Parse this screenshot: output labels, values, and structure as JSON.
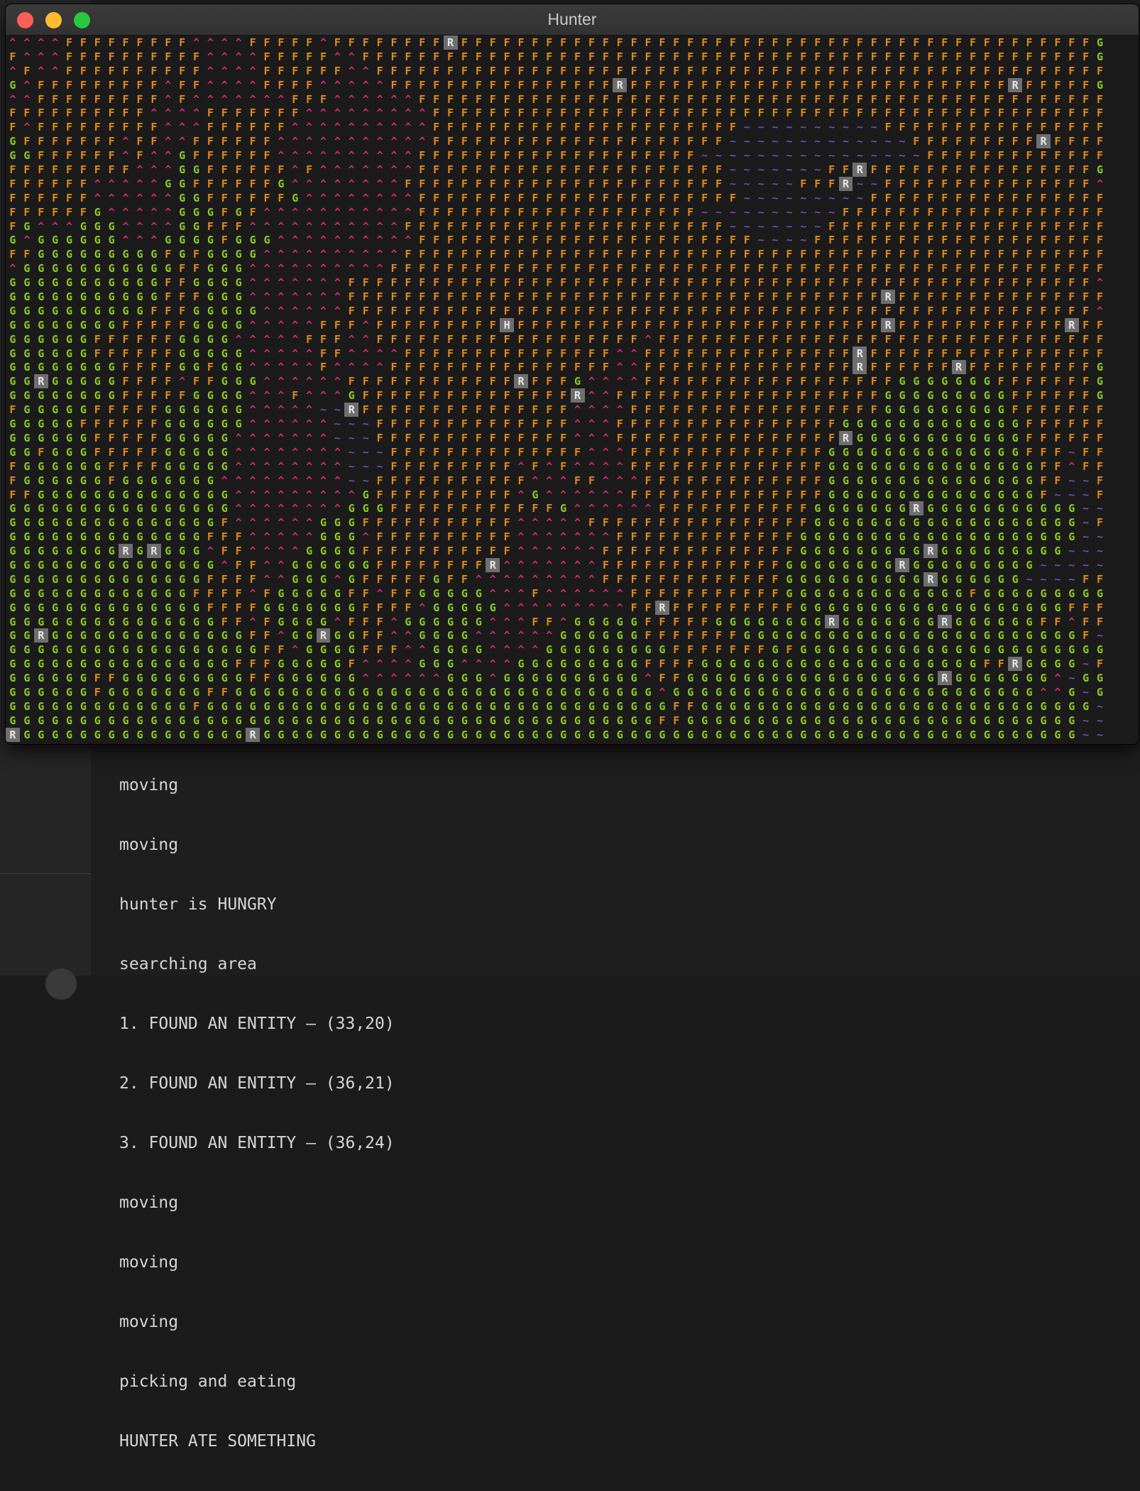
{
  "window": {
    "title": "Hunter"
  },
  "legend": {
    "F": "F",
    "G": "G",
    "M": "^",
    "W": "~",
    "R": "R",
    "H": "H"
  },
  "map": {
    "rows": [
      "MMMMFFFFFFFFFMMMMFFFFFMFFFFFFFFRFFFFFFFFFFFFFFFFFFFFFFFFFFFFFFFFFFFFFFFFFFFFFG",
      "FMMMFFFFFFFFFFMMMMFFFFFMMFFFFFFFFFFFFFFFFFFFFFFFFFFFFFFFFFFFFFFFFFFFFFFFFFFFFG",
      "MFMMFFFFFFFFFFMMMMFFFFFFMMFFFFFFFFFFFFFFFFFFFFFFFFFFFFFFFFFFFFFFFFFFFFFFFFFFFF",
      "GMFFFFFFFFFMFFMMMMFFFFMMMMMFFFFFFFFFFFFFFFFRFFFFFFFFFFFFFFFFFFFFFFFFFFFRFFFFFG",
      "MMFFFFFFFFFMFMMMMMMMFFFMMMMMMFFFFFFFFFFFFFFFFFFFFFFFFFFFFFFFFFFFFFFFFFFFFFFFFF",
      "FFFFFFFFFFMMMMFFFFFFFMMMMMMMMMFFFFFFFFFFFFFFFFFFFFFFFFFFFFFFFFFFFFFFFFFFFFFFFF",
      "FMFFFFFFFFFMMMFFFFFFMMMMMMMMMMFFFFFFFFFFFFFFFFFFFFFFWWWWWWWWWWFFFFFFFFFFFFFFFF",
      "GFFFFFFFMFFMMFFFFFFMMMMMMMMMMMFFFFFFFFFFFFFFFFFFFFFWWWWWWWWWWWWWFFFFFFFFFRFFFF",
      "GGFFFFFFMFMMGFFFFFFMMMMMMMMMMFFFFFFFFFFFFFFFFFFFFWWWWWWWWWWWWWWWWFFFFFFFFFFFFF",
      "FFFFFFFFFMMMGGFFFFFFMFMMMMMMMFFFFFFFFFFFFFFFFFFFFFFWWWWWWWFFRFFFFFFFFFFFFFFFFG",
      "FFFFFFMMMMMGGFFFFFFGMMMMMMMMFFFFFFFFFFFFFFFFFFFFFFFWWWWWFFFRWWFFFFFFFFFFFFFFFM",
      "FFFFFFMMMMMMGGFFFFFFGMMMMMMMMFFFFFFFFFFFFFFFFFFFFFFFWWWWWWWWWFFFFFFFFFFFFFFFFF",
      "FFFFFFGMMMMMGGGFGFMMMMMMMMMMMFFFFFFFFFFFFFFFFFFFFWWWWWWWWWWFFFFFFFFFFFFFFFFFFF",
      "FGMMMGGGMMMMGGFFFMMMMMMMMMMMFFFFFFFFFFFFFFFFFFFFFFFWWWWWWWFFFFFFFFFFFFFFFFFFFF",
      "GMGGGGGGMMMGGGGFGGGMMMMMMMMMMFFFFFFFFFFFFFFFFFFFFFFFFWWWWFFFFFFFFFFFFFFFFFFFFF",
      "FFGGGGGGGGGFGFGGGGMMMMMMMMMMFFFFFFFFFFFFFFFFFFFFFFFFFFFFFFFFFFFFFFFFFFFFFFFFFF",
      "MGGGGGGGGGGGFFGGGMMMMMMMMMMFFFFFFFFFFFFFFFFFFFFFFFFFFFFFFFFFFFFFFFFFFFFFFFFFFF",
      "GGGGGGGGGGGFFGGGGMMMMMMMFFFFFFFFFFFFFFFFFFFFFFFFFFFFFFFFFFFFFFFFFFFFFFFFFFFFFM",
      "GGGGGGGGGGGFFFGGGMMMMMMMFFFFFFFFFFFFFFFFFFFFFFFFFFFFFFFFFFFFFFRFFFFFFFFFFFFFFF",
      "GGGGGGGGGGFFFGGGGGMMMMMMFFFFFFFFFFFFFFFFFFFFFFFFFFFFFFFFFFFFFFFFFFFFFFFFFFFFFM",
      "GGGGGGGGFFFFFGGGGMMMMMFFFMFFFFFFFFFHFFFFFFFFFFFFFFFFFFFFFFFFFFRFFFFFFFFFFFFRFF",
      "GGGGGGFFFFFFGGGGMMMMMFFFMMFFFFFFFFFFFFFFFFFFFMFFFFFFFFFFFFFFFFFFFFFFFFFFFFFFFF",
      "GGGGGGFFFFFFGGGGGMMMMMFFMMMMFFFFFFFFFFFFFFFMMFFFFFFFFFFFFFFFRFFFFFFFFFFFFFFFFF",
      "GGGGGGGGFFFFGGFGGMMMMMFMMMMFFFFFFFFFFFFFFFFMMFFFFFFFFFFFFFFFRFFFFFFRFFFFFFFFFG",
      "GGRGGGGGFFFFMFFGGGMMMMMMFFFFFFFFFFFFRFFFGMMMMFFFFFFFFFFFFFFFFFFGGGGGGGFFFFFFFG",
      "GGGGGGGGFFFFFGGGGMMMFMMMGFFFFFFFFFFFFFFFRMMFFFFFFFFFFFFFFFFFFFGGGGGGGGGFFFFFFG",
      "FGGGGGFFFFFGGGGGGMMMMMWWRFFFFFFFFFFFFFFFMMMMFFFFFFFFFFFFFFFFFFGGGGGGGGGFFFFFFF",
      "GGGGGFFFFFFGGGGGGMMMMMMWWWFFFFFFFFFFFFFFMMMFFFFFFFFFFFFFFFFGGGGGGGGGGGGGFFFFFF",
      "GGGGGGFFFFFGGGGGMMMMMMMWWWFFFFFFFFFFFFFFMMMFFFFFFFFFFFFFFFFRGGGGGGGGGGGGFFFFFF",
      "GGFGGGFFFFFGGGGGMMMMMMMMWWWFFFFFFFFFFFFFFMMMFFFFFFFFFFFFFFGGGGGGGGGGGGGGFFFWFF",
      "FGGGGGGFFFFGGGGGMMMMMMMMWWWFFFFFFFFFMFMFMMMMFFFFFFFFFFFFFFGGGGGGGGGGGGGGGFFMFF",
      "FGGGGGGFGGGGGGGMMMMMMMMMWWFFFFFFFFFFFMMMFFMMMFFFFFFFFFFFFFGGGGGGGGGGGGGGGFFWWF",
      "FFGGGGGGGGGGGGGGMMMMMMMMMGFFFFFFFFFFMGMMMMMMFFFFFFFFFFFFFFGGGGGGGGGGGGGGGFWWWF",
      "GGGGGGGGGGGGGGGGMMMMMMMMGGGFFFFFFFFFFFFGMMMMMMFFFFFFFFFFFGGGGGGGRGGGGGGGGGGGWW",
      "GGGGGGGGGGGGGGGFMMMMMMGGGFFFFFFFFFFFMMMMMFFFFFFFFFFFFFFFFGGGGGGGGGGGGGGGGGGGWF",
      "GGGGGGGGGGGGGGFFFMMMMMGGGMFFFFFFFFFFMMMMMMMFFFFFFFFFFFFFGGGGGGGGGGGGGGGGGGGGWW",
      "GGGGGGGGRGRGGGMFFMMMMGGGGFFFFFFFFFFFMMMMMMFFFFFFFFFFFFFFGGGGGGGGGRGGGGGGGGGWWW",
      "GGGGGGGGGGGGGGGMFFMMGGGGGGFFFFFFFFRMMMMMMMFFFFFFFFFFFFFGGGGGGGGRGGGGGGGGGWWWWW",
      "GGGGGGGGGGGGGGFFFFMMGGGMGFFFFFGFFMMMMMMMMMFFFFFFFFFFFFFGGGGGGGGGGRGGGGGGWWWWFF",
      "GGGGGGGGGGGGGFFFFMFGGGGGFFMFFGGGGGMMMFMMMMMMFFFFFFFFFFFGGGGGGGGGGGGGFGGGGGGGGG",
      "GGGGGGGGGGGGGGFFFFGGGGGGGFFFFMGGGGGMMMMMMMMMFFRFFFFFFFFFGGGGGGGGGGGGGGGGGGGFFF",
      "GGGGGGGGGGGGGGGFFMFGGGGMFFFMGGGGGGMMMFFMGGGGGFFFFFGGGGGGGGRGGGGGGGRGGGGGGFFMFF",
      "GGRGGGGGGGGGGGGGGFFMGGRGGFFMMGGGGMMMMMMGGGGGGFFFFFFFGGGGGGGGGGGGGGGGGGGGGGGGFW",
      "GGGGGGGGGGGGGGGGGGFFMGGGGFFFMMGGGGMMMMGGGGGGGGGFFFFFFFGFGGGGGGGGGGGGGGGGGGGGGG",
      "GGGGGGGGGGGGGGGGFFFGGGGGFMMMMGGGMMMMGGGGGGGGGFFFFGGGGGGGGGGGGGGGGGGGGFFRGGGGWF",
      "GGGGGGFFGGGGGGGGGFFGGGGGGMMMMMMGGGMGGGGGGGGGGMFFGGGGGGGGGGGGGGGGGGRGGGGGGGMWGG",
      "GGGGGGFGGGGGGGFFGGGGGGGGGGGGGGGGGGGGGGGGGGGGGGMGGGGGGGGGGGGGGGGGGGGGGGGGGMMGWG",
      "GGGGGGGGGGGGGFGGGGGGGGGGGGGGGGGGGGGGGGGGGGGGGGGFFGGGGGGGGGGGGGGGGGGGGGGGGGGGGW",
      "GGGGGGGGGGGGGGGGGGGGGGGGGGGGGGGGGGGGGGGGGGGGGGFFGGGGGGGGGGGGGGGGGGGGGGGGGGGGWW",
      "RGGGGGGGGGGGGGGGGRGGGGGGGGGGGGGGGGGGGGGGGGGGGGGGGGGGGGGGGGGGGGGGGGGGGGGGGGGGWW"
    ]
  },
  "console": {
    "lines": [
      "moving",
      "moving",
      "hunter is HUNGRY",
      "searching area",
      "1. FOUND AN ENTITY – (33,20)",
      "2. FOUND AN ENTITY – (36,21)",
      "3. FOUND AN ENTITY – (36,24)",
      "moving",
      "moving",
      "moving",
      "picking and eating",
      "HUNTER ATE SOMETHING"
    ]
  }
}
